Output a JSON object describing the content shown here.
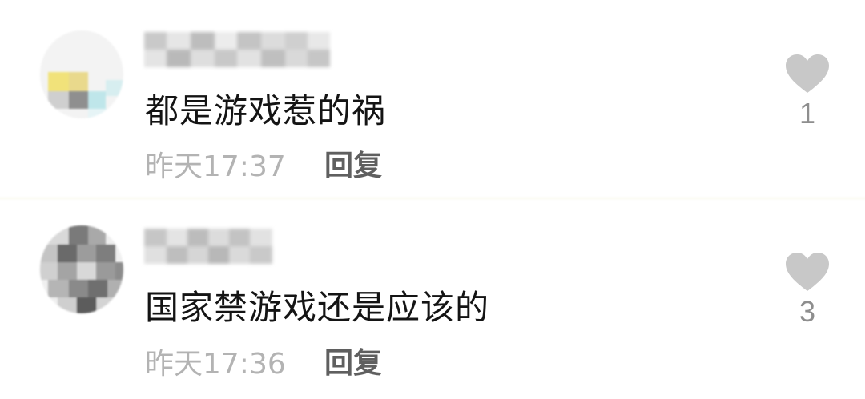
{
  "comments": [
    {
      "text": "都是游戏惹的祸",
      "time": "昨天17:37",
      "reply_label": "回复",
      "likes": "1"
    },
    {
      "text": "国家禁游戏还是应该的",
      "time": "昨天17:36",
      "reply_label": "回复",
      "likes": "3"
    }
  ],
  "colors": {
    "text": "#141414",
    "meta": "#b3b3b3",
    "reply": "#5f5f5f",
    "like_icon": "#c8c8c8",
    "like_count": "#8e8e8e"
  },
  "icons": {
    "like": "heart-icon"
  }
}
